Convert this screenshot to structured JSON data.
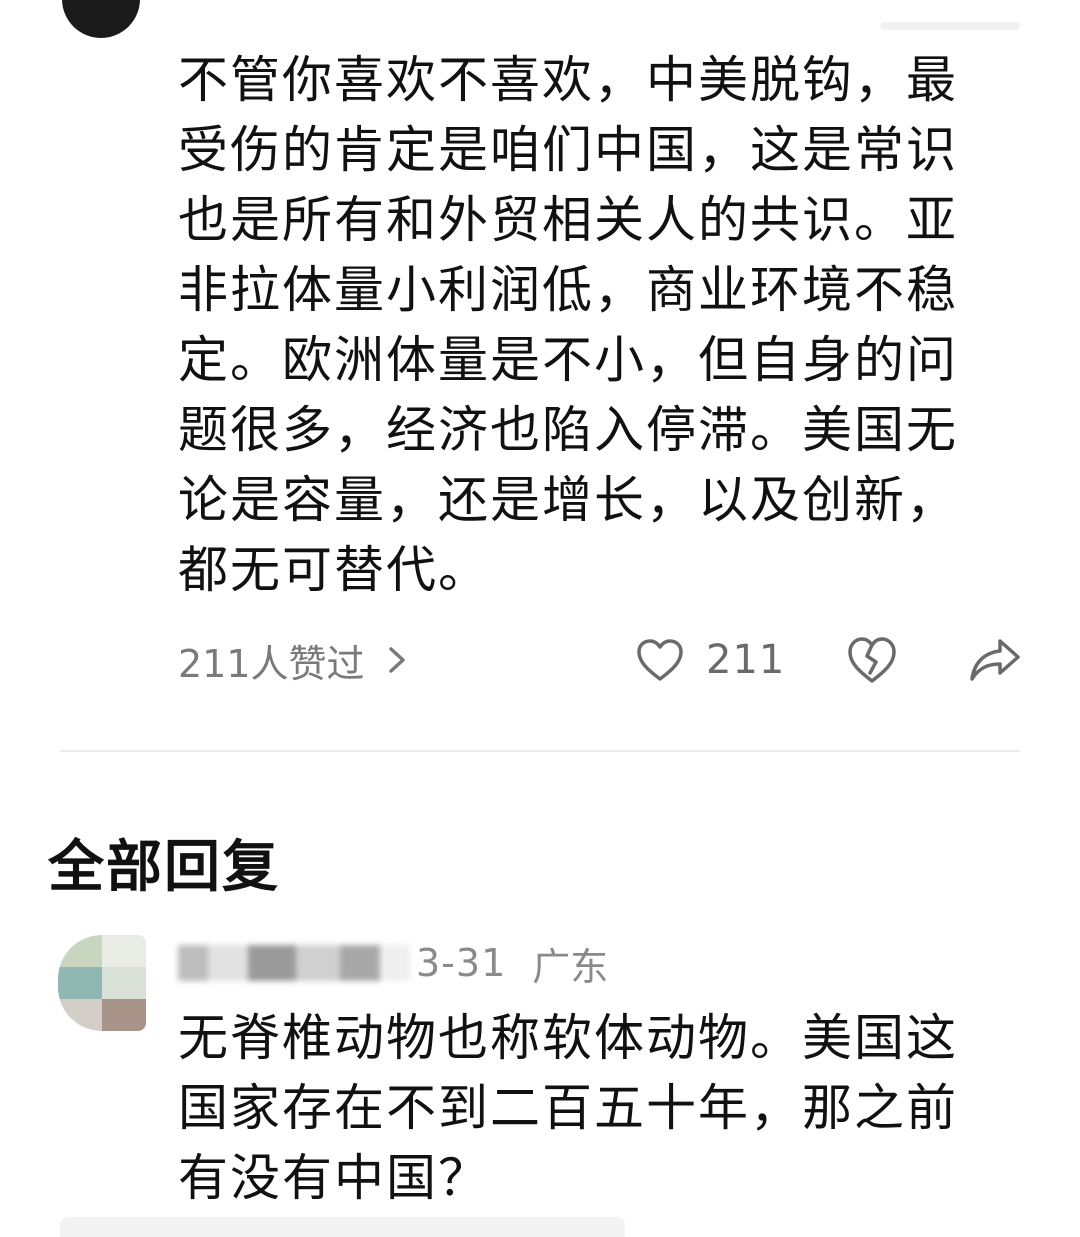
{
  "post": {
    "text": "不管你喜欢不喜欢，中美脱钩，最\n受伤的肯定是咱们中国，这是常识\n也是所有和外贸相关人的共识。亚\n非拉体量小利润低，商业环境不稳\n定。欧洲体量是不小，但自身的问\n题很多，经济也陷入停滞。美国无\n论是容量，还是增长，以及创新，\n都无可替代。",
    "likers_label": "211人赞过",
    "like_count": "211"
  },
  "icons": {
    "likers_chevron": "chevron-right-icon",
    "like": "heart-outline-icon",
    "dislike": "broken-heart-icon",
    "share": "share-arrow-icon"
  },
  "replies_section": {
    "title": "全部回复"
  },
  "reply": {
    "date": "3-31",
    "location": "广东",
    "text": "无脊椎动物也称软体动物。美国这\n国家存在不到二百五十年，那之前\n有没有中国？"
  },
  "colors": {
    "text_primary": "#111111",
    "text_secondary": "#7a7a7a",
    "divider": "#ebebeb"
  }
}
